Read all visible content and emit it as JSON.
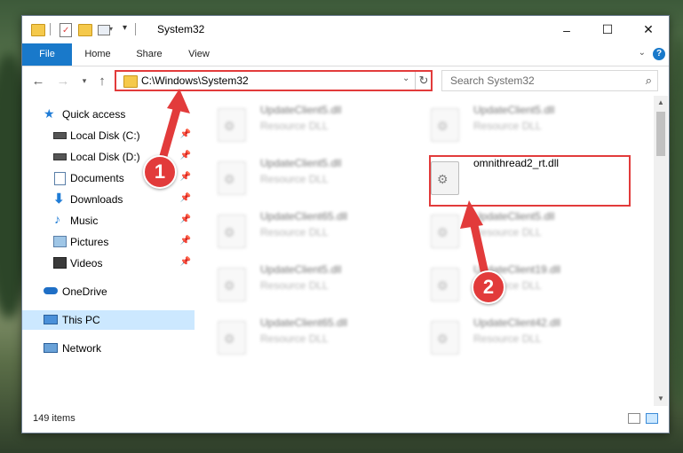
{
  "window": {
    "title": "System32",
    "controls": {
      "minimize": "–",
      "maximize": "☐",
      "close": "✕"
    }
  },
  "ribbon": {
    "tabs": [
      "File",
      "Home",
      "Share",
      "View"
    ],
    "help": "?"
  },
  "address_bar": {
    "path": "C:\\Windows\\System32",
    "search_placeholder": "Search System32"
  },
  "nav_pane": {
    "items": [
      {
        "label": "Quick access",
        "icon": "star-icon",
        "pinned": false
      },
      {
        "label": "Local Disk (C:)",
        "icon": "drive-icon",
        "pinned": true
      },
      {
        "label": "Local Disk (D:)",
        "icon": "drive-icon",
        "pinned": true
      },
      {
        "label": "Documents",
        "icon": "documents-icon",
        "pinned": true
      },
      {
        "label": "Downloads",
        "icon": "download-icon",
        "pinned": true
      },
      {
        "label": "Music",
        "icon": "music-icon",
        "pinned": true
      },
      {
        "label": "Pictures",
        "icon": "pictures-icon",
        "pinned": true
      },
      {
        "label": "Videos",
        "icon": "videos-icon",
        "pinned": true
      },
      {
        "label": "OneDrive",
        "icon": "cloud-icon",
        "pinned": false
      },
      {
        "label": "This PC",
        "icon": "computer-icon",
        "pinned": false,
        "selected": true
      },
      {
        "label": "Network",
        "icon": "network-icon",
        "pinned": false
      }
    ]
  },
  "files": [
    {
      "name": "UpdateClient5.dll",
      "type": "Resource DLL"
    },
    {
      "name": "UpdateClient5.dll",
      "type": "Resource DLL"
    },
    {
      "name": "UpdateClient5.dll",
      "type": "Resource DLL"
    },
    {
      "name": "omnithread2_rt.dll",
      "type": ""
    },
    {
      "name": "UpdateClient65.dll",
      "type": "Resource DLL"
    },
    {
      "name": "UpdateClient5.dll",
      "type": "Resource DLL"
    },
    {
      "name": "UpdateClient5.dll",
      "type": "Resource DLL"
    },
    {
      "name": "UpdateClient19.dll",
      "type": "Resource DLL"
    },
    {
      "name": "UpdateClient65.dll",
      "type": "Resource DLL"
    },
    {
      "name": "UpdateClient42.dll",
      "type": "Resource DLL"
    }
  ],
  "status": {
    "item_count": "149 items"
  },
  "callouts": [
    "1",
    "2"
  ],
  "colors": {
    "accent": "#1979ca",
    "highlight": "#e23b3b",
    "selected": "#cce8ff"
  }
}
